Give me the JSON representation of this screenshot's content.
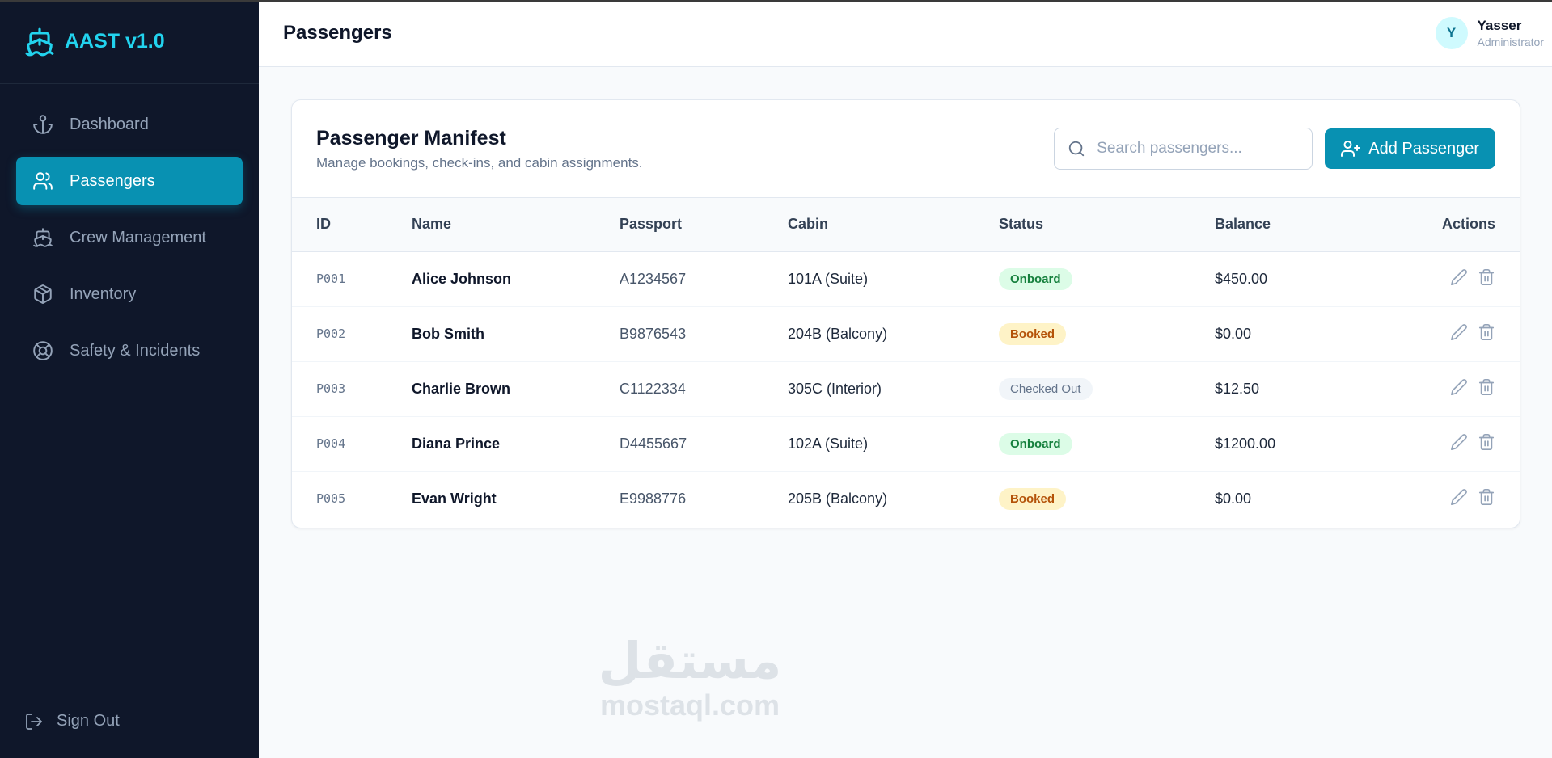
{
  "brand": {
    "name": "AAST v1.0",
    "icon": "ship-icon",
    "color": "#22d3ee"
  },
  "sidebar": {
    "items": [
      {
        "label": "Dashboard",
        "icon": "anchor-icon",
        "active": false
      },
      {
        "label": "Passengers",
        "icon": "users-icon",
        "active": true
      },
      {
        "label": "Crew Management",
        "icon": "ship-icon",
        "active": false
      },
      {
        "label": "Inventory",
        "icon": "package-icon",
        "active": false
      },
      {
        "label": "Safety & Incidents",
        "icon": "life-buoy-icon",
        "active": false
      }
    ],
    "signout_label": "Sign Out"
  },
  "header": {
    "title": "Passengers",
    "user": {
      "initial": "Y",
      "name": "Yasser",
      "role": "Administrator"
    }
  },
  "manifest": {
    "title": "Passenger Manifest",
    "subtitle": "Manage bookings, check-ins, and cabin assignments.",
    "search_placeholder": "Search passengers...",
    "add_label": "Add Passenger",
    "columns": {
      "id": "ID",
      "name": "Name",
      "passport": "Passport",
      "cabin": "Cabin",
      "status": "Status",
      "balance": "Balance",
      "actions": "Actions"
    },
    "rows": [
      {
        "id": "P001",
        "name": "Alice Johnson",
        "passport": "A1234567",
        "cabin": "101A (Suite)",
        "status": "Onboard",
        "balance": "$450.00"
      },
      {
        "id": "P002",
        "name": "Bob Smith",
        "passport": "B9876543",
        "cabin": "204B (Balcony)",
        "status": "Booked",
        "balance": "$0.00"
      },
      {
        "id": "P003",
        "name": "Charlie Brown",
        "passport": "C1122334",
        "cabin": "305C (Interior)",
        "status": "Checked Out",
        "balance": "$12.50"
      },
      {
        "id": "P004",
        "name": "Diana Prince",
        "passport": "D4455667",
        "cabin": "102A (Suite)",
        "status": "Onboard",
        "balance": "$1200.00"
      },
      {
        "id": "P005",
        "name": "Evan Wright",
        "passport": "E9988776",
        "cabin": "205B (Balcony)",
        "status": "Booked",
        "balance": "$0.00"
      }
    ]
  },
  "colors": {
    "accent": "#0891b2",
    "sidebar_bg": "#0f172a",
    "status_onboard": "#15803d",
    "status_booked": "#b45309",
    "status_checked_out": "#64748b"
  },
  "watermark": {
    "arabic": "مستقل",
    "latin": "mostaql.com"
  }
}
